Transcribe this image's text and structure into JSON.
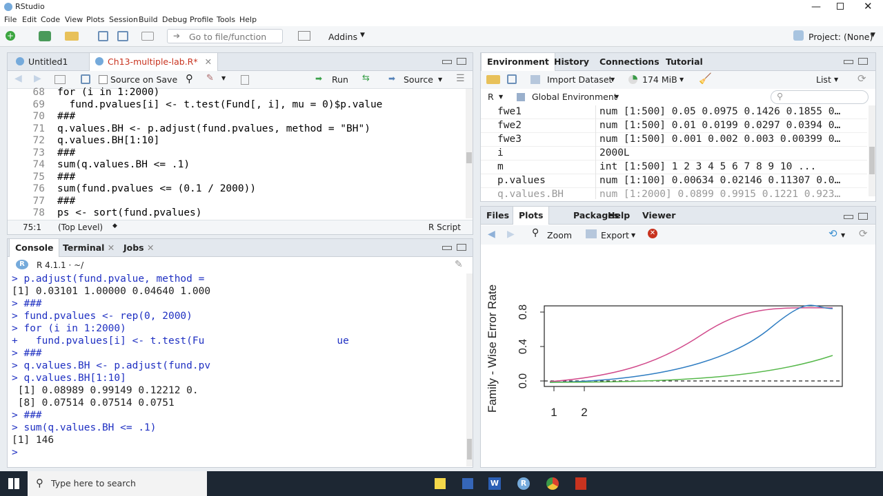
{
  "window": {
    "title": "RStudio"
  },
  "menu": [
    "File",
    "Edit",
    "Code",
    "View",
    "Plots",
    "Session",
    "Build",
    "Debug",
    "Profile",
    "Tools",
    "Help"
  ],
  "toolbar": {
    "goto_placeholder": "Go to file/function",
    "addins": "Addins",
    "project": "Project: (None)"
  },
  "editor": {
    "tabs": [
      "Untitled1",
      "Ch13-multiple-lab.R*"
    ],
    "source_on_save": "Source on Save",
    "run": "Run",
    "source": "Source",
    "lines": [
      {
        "n": "68",
        "t": "for (i in 1:2000)"
      },
      {
        "n": "69",
        "t": "  fund.pvalues[i] <- t.test(Fund[, i], mu = 0)$p.value"
      },
      {
        "n": "70",
        "t": "###"
      },
      {
        "n": "71",
        "t": "q.values.BH <- p.adjust(fund.pvalues, method = \"BH\")"
      },
      {
        "n": "72",
        "t": "q.values.BH[1:10]"
      },
      {
        "n": "73",
        "t": "###"
      },
      {
        "n": "74",
        "t": "sum(q.values.BH <= .1)"
      },
      {
        "n": "75",
        "t": "###"
      },
      {
        "n": "76",
        "t": "sum(fund.pvalues <= (0.1 / 2000))"
      },
      {
        "n": "77",
        "t": "###"
      },
      {
        "n": "78",
        "t": "ps <- sort(fund.pvalues)"
      }
    ],
    "status_pos": "75:1",
    "status_level": "(Top Level)",
    "status_type": "R Script"
  },
  "console": {
    "tabs": [
      "Console",
      "Terminal",
      "Jobs"
    ],
    "version": "R 4.1.1 · ~/",
    "lines": [
      {
        "t": "> p.adjust(fund.pvalue, method = ",
        "c": "blue"
      },
      {
        "t": "[1] 0.03101 1.00000 0.04640 1.000",
        "c": "black"
      },
      {
        "t": "> ###",
        "c": "blue"
      },
      {
        "t": "> fund.pvalues <- rep(0, 2000)",
        "c": "blue"
      },
      {
        "t": "> for (i in 1:2000)",
        "c": "blue"
      },
      {
        "t": "+   fund.pvalues[i] <- t.test(Fu                      ue",
        "c": "blue"
      },
      {
        "t": "> ###",
        "c": "blue"
      },
      {
        "t": "> q.values.BH <- p.adjust(fund.pv",
        "c": "blue"
      },
      {
        "t": "> q.values.BH[1:10]",
        "c": "blue"
      },
      {
        "t": " [1] 0.08989 0.99149 0.12212 0.",
        "c": "black"
      },
      {
        "t": " [8] 0.07514 0.07514 0.0751",
        "c": "black"
      },
      {
        "t": "> ###",
        "c": "blue"
      },
      {
        "t": "> sum(q.values.BH <= .1)",
        "c": "blue"
      },
      {
        "t": "[1] 146",
        "c": "black"
      },
      {
        "t": "> ",
        "c": "blue"
      }
    ]
  },
  "environment": {
    "tabs": [
      "Environment",
      "History",
      "Connections",
      "Tutorial"
    ],
    "import_dataset": "Import Dataset",
    "memory": "174 MiB",
    "list": "List",
    "lang": "R",
    "scope": "Global Environment",
    "rows": [
      {
        "name": "fwe1",
        "value": "num [1:500] 0.05 0.0975 0.1426 0.1855 0…"
      },
      {
        "name": "fwe2",
        "value": "num [1:500] 0.01 0.0199 0.0297 0.0394 0…"
      },
      {
        "name": "fwe3",
        "value": "num [1:500] 0.001 0.002 0.003 0.00399 0…"
      },
      {
        "name": "i",
        "value": "2000L"
      },
      {
        "name": "m",
        "value": "int [1:500] 1 2 3 4 5 6 7 8 9 10 ..."
      },
      {
        "name": "p.values",
        "value": "num [1:100] 0.00634 0.02146 0.11307 0.0…"
      },
      {
        "name": "q.values.BH",
        "value": "num [1:2000] 0.0899 0.9915 0.1221 0.923…"
      }
    ]
  },
  "plots": {
    "tabs": [
      "Files",
      "Plots",
      "Packages",
      "Help",
      "Viewer"
    ],
    "zoom": "Zoom",
    "export": "Export"
  },
  "chart_data": {
    "type": "line",
    "ylabel": "Family - Wise Error Rate",
    "yticks": [
      "0.0",
      "0.4",
      "0.8"
    ],
    "xticks": [
      "1",
      "2"
    ],
    "hline": 0.05
  },
  "taskbar": {
    "search_placeholder": "Type here to search"
  },
  "colors": {
    "accent": "#75aadb",
    "code_blue": "#1f30c2",
    "taskbar": "#1d2733"
  }
}
